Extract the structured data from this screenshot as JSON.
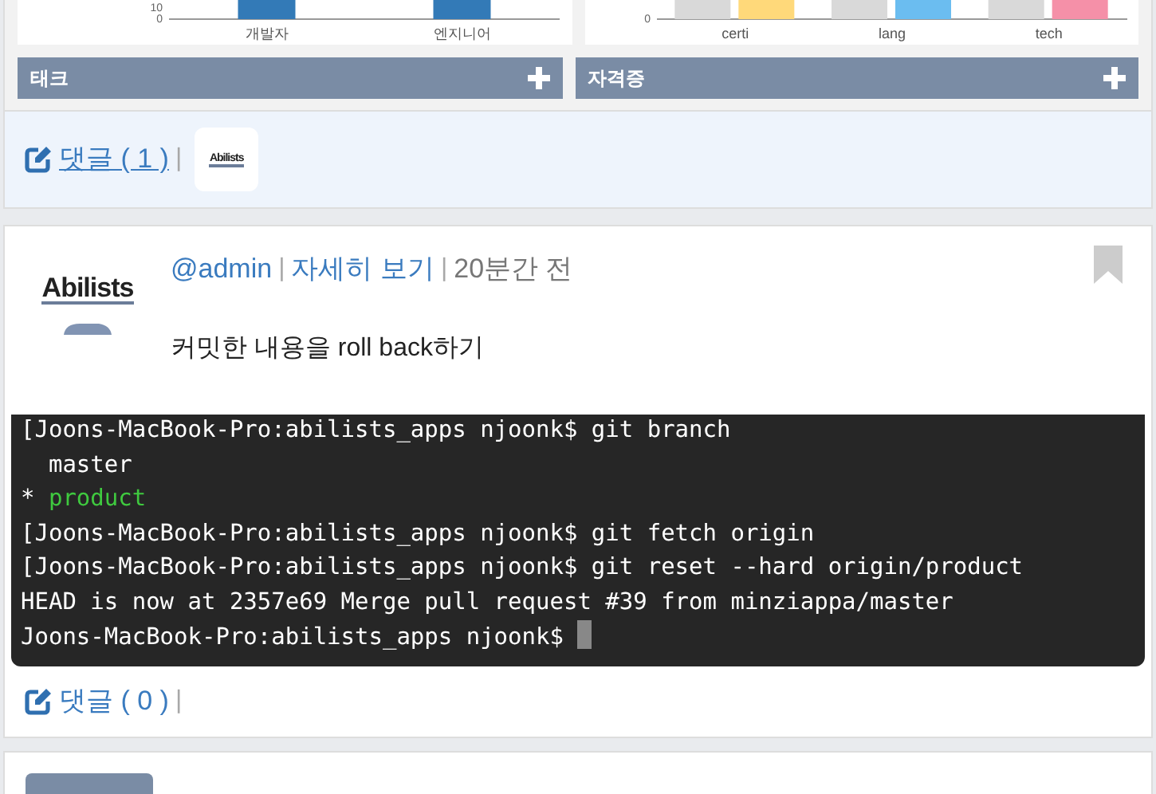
{
  "charts": [
    {
      "y_labels": [
        "10",
        "0"
      ],
      "categories": [
        "개발자",
        "엔지니어"
      ]
    },
    {
      "y_labels": [
        "0"
      ],
      "categories": [
        "certi",
        "lang",
        "tech"
      ]
    }
  ],
  "panels": [
    {
      "title": "태크"
    },
    {
      "title": "자격증"
    }
  ],
  "comment_bar": {
    "label": "댓글 ( 1 )",
    "hovered": true,
    "separator": "|",
    "avatar_logo": "Abilists"
  },
  "post": {
    "logo": "Abilists",
    "author": "@admin",
    "separator_1": "|",
    "detail_link": "자세히 보기",
    "separator_2": "|",
    "time": "20분간 전",
    "bookmarked": false,
    "body": "커밋한 내용을 roll back하기",
    "terminal": {
      "cursor": true,
      "lines": [
        {
          "kind": "command",
          "text": "[Joons-MacBook-Pro:abilists_apps njoonk$ git branch"
        },
        {
          "kind": "output",
          "text": "  master"
        },
        {
          "kind": "current_branch",
          "marker": "* ",
          "text": "product"
        },
        {
          "kind": "command",
          "text": "[Joons-MacBook-Pro:abilists_apps njoonk$ git fetch origin"
        },
        {
          "kind": "command",
          "text": "[Joons-MacBook-Pro:abilists_apps njoonk$ git reset --hard origin/product"
        },
        {
          "kind": "output",
          "text": "HEAD is now at 2357e69 Merge pull request #39 from minziappa/master"
        },
        {
          "kind": "command",
          "text": "Joons-MacBook-Pro:abilists_apps njoonk$ "
        }
      ]
    },
    "comments": {
      "label": "댓글 ( 0 )",
      "hovered": false,
      "separator": "|"
    }
  }
}
